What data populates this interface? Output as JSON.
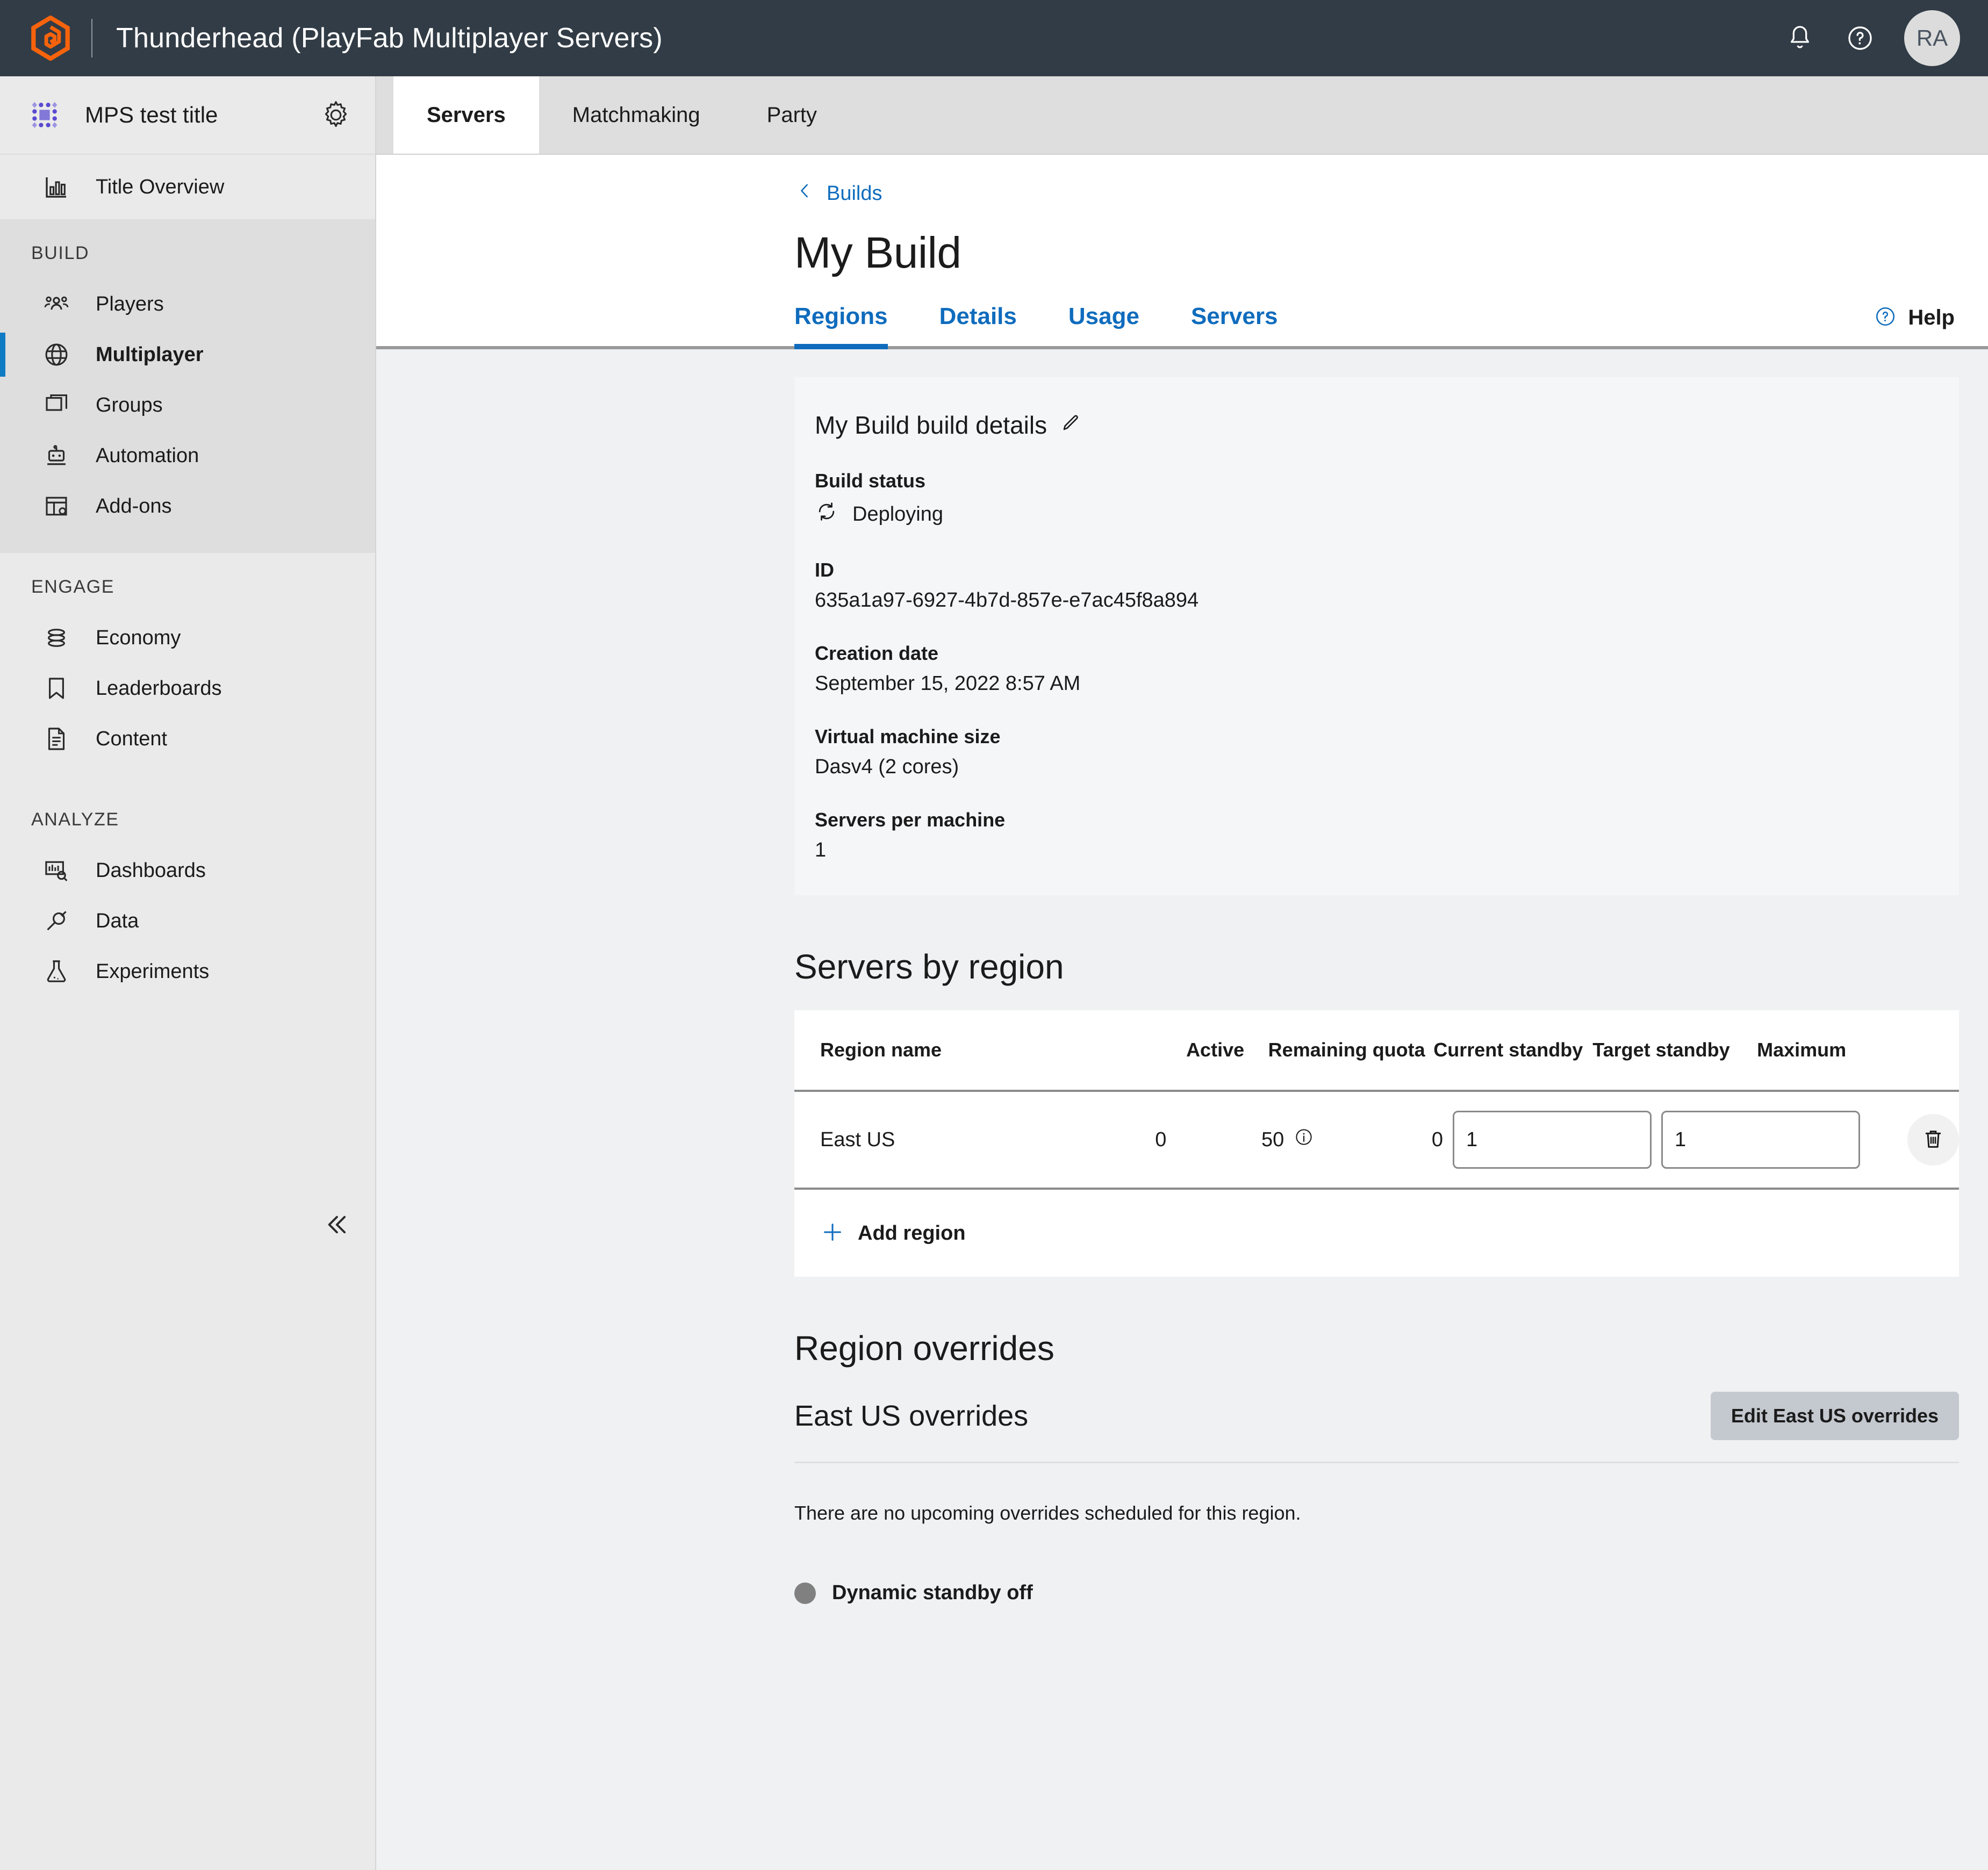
{
  "topbar": {
    "logo_icon": "thunderhead-logo-icon",
    "app_title": "Thunderhead (PlayFab Multiplayer Servers)",
    "notifications_icon": "bell-icon",
    "help_icon": "question-circle-icon",
    "avatar_initials": "RA",
    "background": "#323c46",
    "logo_color": "#f7630c"
  },
  "sidebar": {
    "title_icon": "title-grid-icon",
    "title_name": "MPS test title",
    "settings_icon": "gear-icon",
    "overview": {
      "icon": "chart-bars-icon",
      "label": "Title Overview"
    },
    "groups": [
      {
        "heading": "BUILD",
        "items": [
          {
            "icon": "people-icon",
            "label": "Players",
            "active": false
          },
          {
            "icon": "globe-icon",
            "label": "Multiplayer",
            "active": true
          },
          {
            "icon": "stacked-windows-icon",
            "label": "Groups",
            "active": false
          },
          {
            "icon": "robot-icon",
            "label": "Automation",
            "active": false
          },
          {
            "icon": "addons-grid-icon",
            "label": "Add-ons",
            "active": false
          }
        ]
      },
      {
        "heading": "ENGAGE",
        "items": [
          {
            "icon": "coins-stack-icon",
            "label": "Economy",
            "active": false
          },
          {
            "icon": "bookmark-icon",
            "label": "Leaderboards",
            "active": false
          },
          {
            "icon": "document-icon",
            "label": "Content",
            "active": false
          }
        ]
      },
      {
        "heading": "ANALYZE",
        "items": [
          {
            "icon": "dashboard-search-icon",
            "label": "Dashboards",
            "active": false
          },
          {
            "icon": "plug-icon",
            "label": "Data",
            "active": false
          },
          {
            "icon": "flask-icon",
            "label": "Experiments",
            "active": false
          }
        ]
      }
    ],
    "collapse_icon": "chevron-double-left-icon",
    "active_accent": "#0f7bc4"
  },
  "tabs": {
    "items": [
      "Servers",
      "Matchmaking",
      "Party"
    ],
    "selected": "Servers"
  },
  "page": {
    "breadcrumb_icon": "chevron-left-icon",
    "breadcrumb_label": "Builds",
    "title": "My Build",
    "subtabs": [
      "Regions",
      "Details",
      "Usage",
      "Servers"
    ],
    "selected_subtab": "Regions",
    "help_icon": "question-circle-icon",
    "help_label": "Help",
    "link_color": "#0f6cbd"
  },
  "details": {
    "heading": "My Build build details",
    "edit_icon": "pencil-icon",
    "fields": [
      {
        "label": "Build status",
        "value": "Deploying",
        "icon": "sync-refresh-icon"
      },
      {
        "label": "ID",
        "value": "635a1a97-6927-4b7d-857e-e7ac45f8a894",
        "icon": ""
      },
      {
        "label": "Creation date",
        "value": "September 15, 2022 8:57 AM",
        "icon": ""
      },
      {
        "label": "Virtual machine size",
        "value": "Dasv4 (2 cores)",
        "icon": ""
      },
      {
        "label": "Servers per machine",
        "value": "1",
        "icon": ""
      }
    ]
  },
  "servers_by_region": {
    "heading": "Servers by region",
    "columns": [
      "Region name",
      "Active",
      "Remaining quota",
      "Current standby",
      "Target standby",
      "Maximum"
    ],
    "rows": [
      {
        "region_name": "East US",
        "active": "0",
        "remaining_quota": "50",
        "quota_info_icon": "info-circle-icon",
        "current_standby": "0",
        "target_standby": "1",
        "maximum": "1",
        "delete_icon": "trash-icon"
      }
    ],
    "add_icon": "plus-icon",
    "add_label": "Add region"
  },
  "region_overrides": {
    "heading": "Region overrides",
    "subheading": "East US overrides",
    "edit_button": "Edit East US overrides",
    "empty_note": "There are no upcoming overrides scheduled for this region.",
    "standby_status": "Dynamic standby off",
    "standby_dot_color": "#808080"
  }
}
